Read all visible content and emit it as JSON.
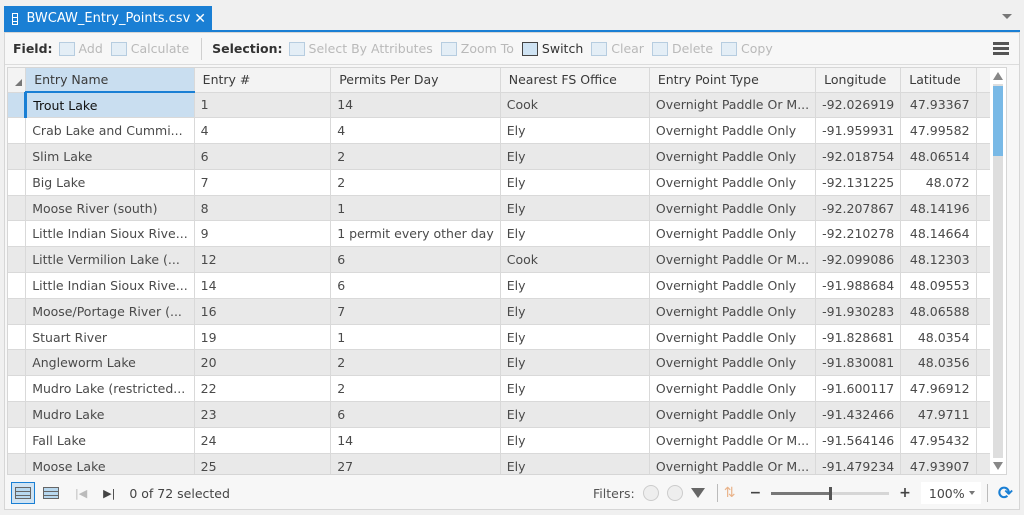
{
  "tab": {
    "title": "BWCAW_Entry_Points.csv",
    "close_glyph": "✕",
    "icon": "table-icon"
  },
  "toolbar": {
    "field_label": "Field:",
    "add_label": "Add",
    "calculate_label": "Calculate",
    "selection_label": "Selection:",
    "select_by_attributes_label": "Select By Attributes",
    "zoom_to_label": "Zoom To",
    "switch_label": "Switch",
    "clear_label": "Clear",
    "delete_label": "Delete",
    "copy_label": "Copy"
  },
  "table": {
    "columns": [
      "Entry Name",
      "Entry #",
      "Permits Per Day",
      "Nearest FS Office",
      "Entry Point Type",
      "Longitude",
      "Latitude"
    ],
    "rows": [
      [
        "Trout Lake",
        "1",
        "14",
        "Cook",
        "Overnight Paddle Or M...",
        "-92.026919",
        "47.93367"
      ],
      [
        "Crab Lake and Cummi...",
        "4",
        "4",
        "Ely",
        "Overnight Paddle Only",
        "-91.959931",
        "47.99582"
      ],
      [
        "Slim Lake",
        "6",
        "2",
        "Ely",
        "Overnight Paddle Only",
        "-92.018754",
        "48.06514"
      ],
      [
        "Big Lake",
        "7",
        "2",
        "Ely",
        "Overnight Paddle Only",
        "-92.131225",
        "48.072"
      ],
      [
        "Moose River (south)",
        "8",
        "1",
        "Ely",
        "Overnight Paddle Only",
        "-92.207867",
        "48.14196"
      ],
      [
        "Little Indian Sioux Rive...",
        "9",
        "1 permit every other day",
        "Ely",
        "Overnight Paddle Only",
        "-92.210278",
        "48.14664"
      ],
      [
        "Little Vermilion Lake (...",
        "12",
        "6",
        "Cook",
        "Overnight Paddle Or M...",
        "-92.099086",
        "48.12303"
      ],
      [
        "Little Indian Sioux Rive...",
        "14",
        "6",
        "Ely",
        "Overnight Paddle Only",
        "-91.988684",
        "48.09553"
      ],
      [
        "Moose/Portage River (...",
        "16",
        "7",
        "Ely",
        "Overnight Paddle Only",
        "-91.930283",
        "48.06588"
      ],
      [
        "Stuart River",
        "19",
        "1",
        "Ely",
        "Overnight Paddle Only",
        "-91.828681",
        "48.0354"
      ],
      [
        "Angleworm Lake",
        "20",
        "2",
        "Ely",
        "Overnight Paddle Only",
        "-91.830081",
        "48.0356"
      ],
      [
        "Mudro Lake (restricted...",
        "22",
        "2",
        "Ely",
        "Overnight Paddle Only",
        "-91.600117",
        "47.96912"
      ],
      [
        "Mudro Lake",
        "23",
        "6",
        "Ely",
        "Overnight Paddle Only",
        "-91.432466",
        "47.9711"
      ],
      [
        "Fall Lake",
        "24",
        "14",
        "Ely",
        "Overnight Paddle Or M...",
        "-91.564146",
        "47.95432"
      ],
      [
        "Moose Lake",
        "25",
        "27",
        "Ely",
        "Overnight Paddle Or M...",
        "-91.479234",
        "47.93907"
      ]
    ],
    "selected_row_index": 0,
    "scroll_position_fraction": 0.0
  },
  "status": {
    "selected_text": "0 of 72 selected",
    "filters_label": "Filters:",
    "zoom_minus": "−",
    "zoom_plus": "+",
    "zoom_value": "100%",
    "zoom_slider_fraction": 0.5
  },
  "colors": {
    "accent": "#1a7fd4",
    "selected_cell": "#c9def0",
    "scroll_thumb": "#79b9e6"
  }
}
